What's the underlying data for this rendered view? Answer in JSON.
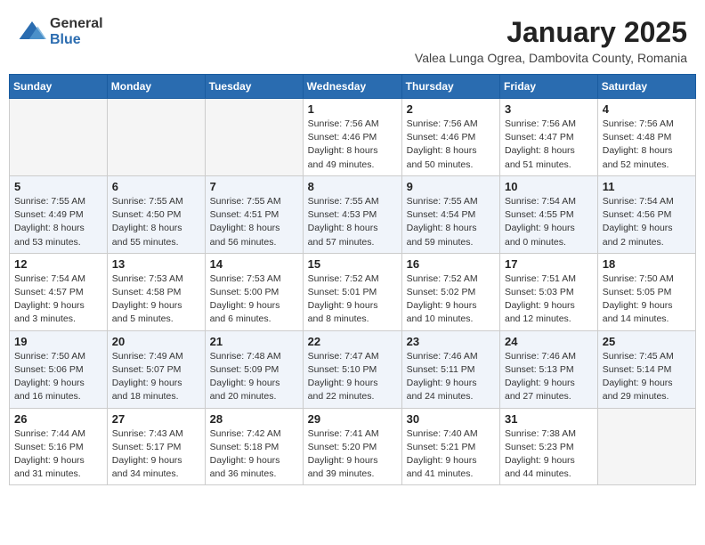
{
  "logo": {
    "general": "General",
    "blue": "Blue"
  },
  "title": "January 2025",
  "location": "Valea Lunga Ogrea, Dambovita County, Romania",
  "days_of_week": [
    "Sunday",
    "Monday",
    "Tuesday",
    "Wednesday",
    "Thursday",
    "Friday",
    "Saturday"
  ],
  "weeks": [
    [
      {
        "day": "",
        "info": ""
      },
      {
        "day": "",
        "info": ""
      },
      {
        "day": "",
        "info": ""
      },
      {
        "day": "1",
        "info": "Sunrise: 7:56 AM\nSunset: 4:46 PM\nDaylight: 8 hours\nand 49 minutes."
      },
      {
        "day": "2",
        "info": "Sunrise: 7:56 AM\nSunset: 4:46 PM\nDaylight: 8 hours\nand 50 minutes."
      },
      {
        "day": "3",
        "info": "Sunrise: 7:56 AM\nSunset: 4:47 PM\nDaylight: 8 hours\nand 51 minutes."
      },
      {
        "day": "4",
        "info": "Sunrise: 7:56 AM\nSunset: 4:48 PM\nDaylight: 8 hours\nand 52 minutes."
      }
    ],
    [
      {
        "day": "5",
        "info": "Sunrise: 7:55 AM\nSunset: 4:49 PM\nDaylight: 8 hours\nand 53 minutes."
      },
      {
        "day": "6",
        "info": "Sunrise: 7:55 AM\nSunset: 4:50 PM\nDaylight: 8 hours\nand 55 minutes."
      },
      {
        "day": "7",
        "info": "Sunrise: 7:55 AM\nSunset: 4:51 PM\nDaylight: 8 hours\nand 56 minutes."
      },
      {
        "day": "8",
        "info": "Sunrise: 7:55 AM\nSunset: 4:53 PM\nDaylight: 8 hours\nand 57 minutes."
      },
      {
        "day": "9",
        "info": "Sunrise: 7:55 AM\nSunset: 4:54 PM\nDaylight: 8 hours\nand 59 minutes."
      },
      {
        "day": "10",
        "info": "Sunrise: 7:54 AM\nSunset: 4:55 PM\nDaylight: 9 hours\nand 0 minutes."
      },
      {
        "day": "11",
        "info": "Sunrise: 7:54 AM\nSunset: 4:56 PM\nDaylight: 9 hours\nand 2 minutes."
      }
    ],
    [
      {
        "day": "12",
        "info": "Sunrise: 7:54 AM\nSunset: 4:57 PM\nDaylight: 9 hours\nand 3 minutes."
      },
      {
        "day": "13",
        "info": "Sunrise: 7:53 AM\nSunset: 4:58 PM\nDaylight: 9 hours\nand 5 minutes."
      },
      {
        "day": "14",
        "info": "Sunrise: 7:53 AM\nSunset: 5:00 PM\nDaylight: 9 hours\nand 6 minutes."
      },
      {
        "day": "15",
        "info": "Sunrise: 7:52 AM\nSunset: 5:01 PM\nDaylight: 9 hours\nand 8 minutes."
      },
      {
        "day": "16",
        "info": "Sunrise: 7:52 AM\nSunset: 5:02 PM\nDaylight: 9 hours\nand 10 minutes."
      },
      {
        "day": "17",
        "info": "Sunrise: 7:51 AM\nSunset: 5:03 PM\nDaylight: 9 hours\nand 12 minutes."
      },
      {
        "day": "18",
        "info": "Sunrise: 7:50 AM\nSunset: 5:05 PM\nDaylight: 9 hours\nand 14 minutes."
      }
    ],
    [
      {
        "day": "19",
        "info": "Sunrise: 7:50 AM\nSunset: 5:06 PM\nDaylight: 9 hours\nand 16 minutes."
      },
      {
        "day": "20",
        "info": "Sunrise: 7:49 AM\nSunset: 5:07 PM\nDaylight: 9 hours\nand 18 minutes."
      },
      {
        "day": "21",
        "info": "Sunrise: 7:48 AM\nSunset: 5:09 PM\nDaylight: 9 hours\nand 20 minutes."
      },
      {
        "day": "22",
        "info": "Sunrise: 7:47 AM\nSunset: 5:10 PM\nDaylight: 9 hours\nand 22 minutes."
      },
      {
        "day": "23",
        "info": "Sunrise: 7:46 AM\nSunset: 5:11 PM\nDaylight: 9 hours\nand 24 minutes."
      },
      {
        "day": "24",
        "info": "Sunrise: 7:46 AM\nSunset: 5:13 PM\nDaylight: 9 hours\nand 27 minutes."
      },
      {
        "day": "25",
        "info": "Sunrise: 7:45 AM\nSunset: 5:14 PM\nDaylight: 9 hours\nand 29 minutes."
      }
    ],
    [
      {
        "day": "26",
        "info": "Sunrise: 7:44 AM\nSunset: 5:16 PM\nDaylight: 9 hours\nand 31 minutes."
      },
      {
        "day": "27",
        "info": "Sunrise: 7:43 AM\nSunset: 5:17 PM\nDaylight: 9 hours\nand 34 minutes."
      },
      {
        "day": "28",
        "info": "Sunrise: 7:42 AM\nSunset: 5:18 PM\nDaylight: 9 hours\nand 36 minutes."
      },
      {
        "day": "29",
        "info": "Sunrise: 7:41 AM\nSunset: 5:20 PM\nDaylight: 9 hours\nand 39 minutes."
      },
      {
        "day": "30",
        "info": "Sunrise: 7:40 AM\nSunset: 5:21 PM\nDaylight: 9 hours\nand 41 minutes."
      },
      {
        "day": "31",
        "info": "Sunrise: 7:38 AM\nSunset: 5:23 PM\nDaylight: 9 hours\nand 44 minutes."
      },
      {
        "day": "",
        "info": ""
      }
    ]
  ]
}
